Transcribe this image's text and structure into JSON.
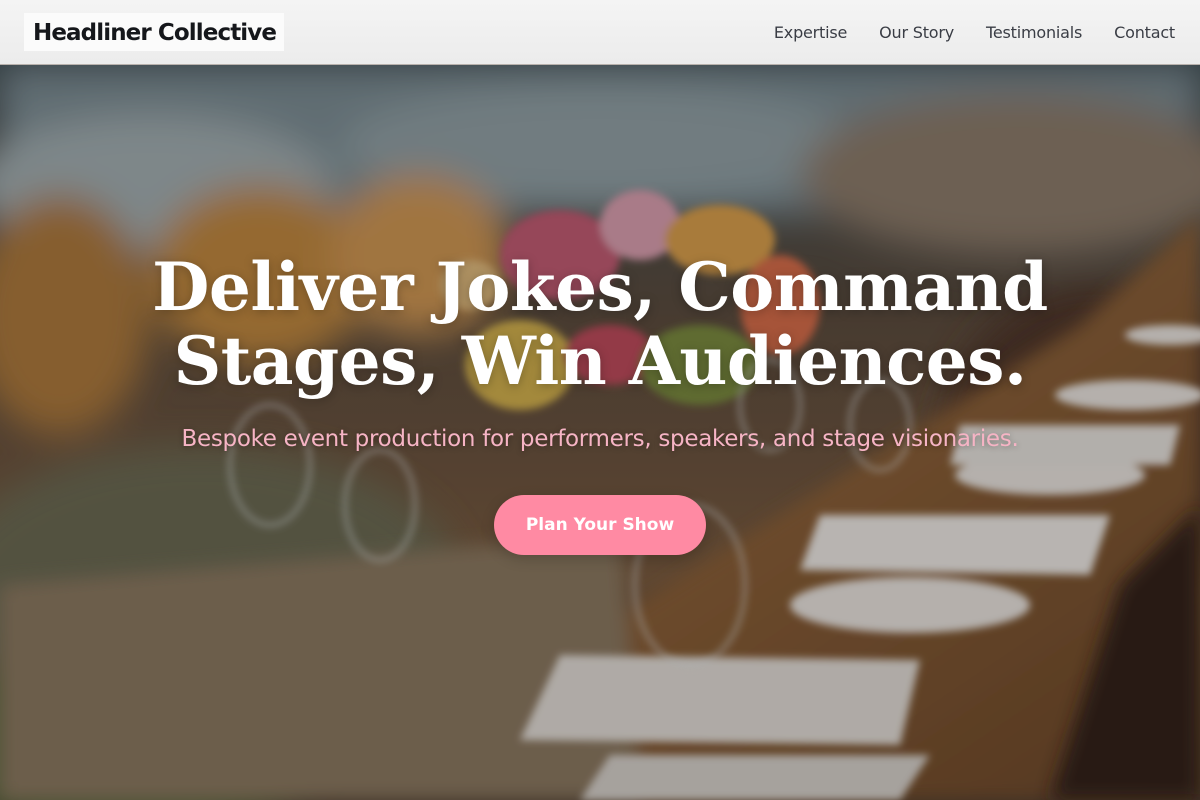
{
  "brand": {
    "name": "Headliner Collective"
  },
  "nav": {
    "items": [
      {
        "label": "Expertise"
      },
      {
        "label": "Our Story"
      },
      {
        "label": "Testimonials"
      },
      {
        "label": "Contact"
      }
    ]
  },
  "hero": {
    "headline_line1": "Deliver Jokes, Command",
    "headline_line2": "Stages, Win Audiences.",
    "subheadline": "Bespoke event production for performers, speakers, and stage visionaries.",
    "cta_label": "Plan Your Show"
  },
  "colors": {
    "accent": "#ff8aa3",
    "subheadline": "#f6b4c5",
    "header_bg": "#f1f1f1"
  }
}
